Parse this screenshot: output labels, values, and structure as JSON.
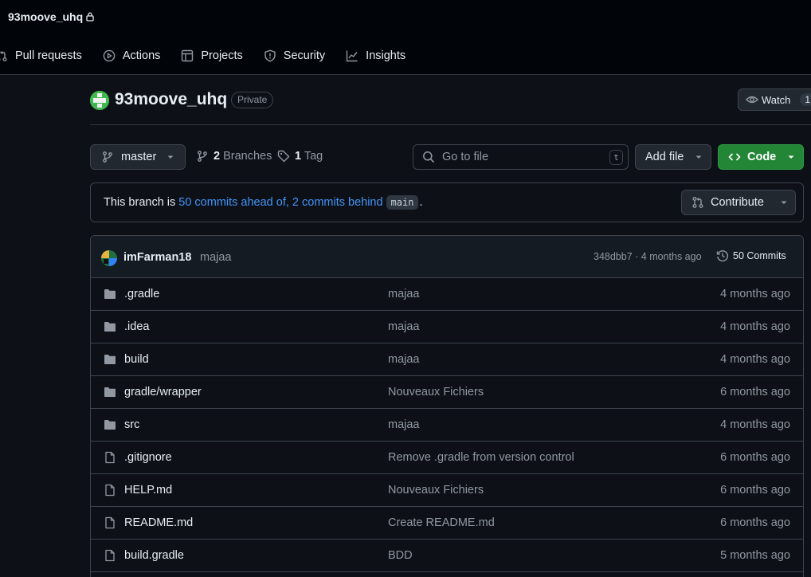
{
  "repo": {
    "short_name": "93moove_uhq",
    "name": "93moove_uhq",
    "visibility": "Private"
  },
  "nav": [
    {
      "label": "Pull requests",
      "icon": "pull-request-icon"
    },
    {
      "label": "Actions",
      "icon": "play-icon"
    },
    {
      "label": "Projects",
      "icon": "table-icon"
    },
    {
      "label": "Security",
      "icon": "shield-icon"
    },
    {
      "label": "Insights",
      "icon": "graph-icon"
    }
  ],
  "watch": {
    "label": "Watch",
    "count": "1"
  },
  "toolbar": {
    "branch": "master",
    "branches_count": "2",
    "branches_label": "Branches",
    "tags_count": "1",
    "tags_label": "Tag",
    "search_placeholder": "Go to file",
    "search_shortcut": "t",
    "add_file": "Add file",
    "code": "Code"
  },
  "banner": {
    "prefix": "This branch is",
    "ahead": "50 commits ahead of,",
    "behind": "2 commits behind",
    "base": "main",
    "suffix": ".",
    "contribute": "Contribute"
  },
  "latest_commit": {
    "author": "imFarman18",
    "message": "majaa",
    "meta": "348dbb7 · 4 months ago",
    "commits_label": "50 Commits"
  },
  "files": [
    {
      "name": ".gradle",
      "type": "folder",
      "message": "majaa",
      "date": "4 months ago"
    },
    {
      "name": ".idea",
      "type": "folder",
      "message": "majaa",
      "date": "4 months ago"
    },
    {
      "name": "build",
      "type": "folder",
      "message": "majaa",
      "date": "4 months ago"
    },
    {
      "name": "gradle/wrapper",
      "type": "folder",
      "message": "Nouveaux Fichiers",
      "date": "6 months ago"
    },
    {
      "name": "src",
      "type": "folder",
      "message": "majaa",
      "date": "4 months ago"
    },
    {
      "name": ".gitignore",
      "type": "file",
      "message": "Remove .gradle from version control",
      "date": "6 months ago"
    },
    {
      "name": "HELP.md",
      "type": "file",
      "message": "Nouveaux Fichiers",
      "date": "6 months ago"
    },
    {
      "name": "README.md",
      "type": "file",
      "message": "Create README.md",
      "date": "6 months ago"
    },
    {
      "name": "build.gradle",
      "type": "file",
      "message": "BDD",
      "date": "5 months ago"
    }
  ],
  "colors": {
    "background": "#0d1117",
    "header": "#010409",
    "accent_link": "#4493f8",
    "code_button": "#238636",
    "folder_icon": "#9198a1"
  }
}
